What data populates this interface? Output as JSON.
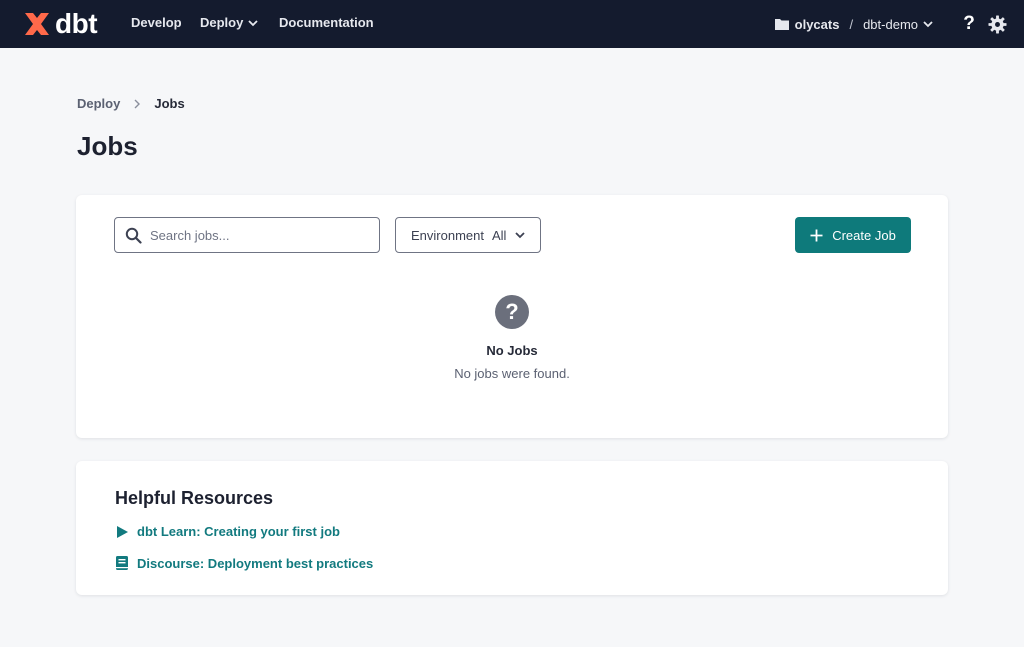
{
  "app": {
    "brand": "dbt",
    "brand_color": "#ff694a",
    "accent_color": "#0e7a7b"
  },
  "nav": {
    "items": [
      {
        "label": "Develop"
      },
      {
        "label": "Deploy",
        "has_dropdown": true
      },
      {
        "label": "Documentation"
      }
    ],
    "account": "olycats",
    "separator": "/",
    "project": "dbt-demo",
    "help_icon": "question-icon",
    "settings_icon": "gear-icon"
  },
  "breadcrumb": {
    "parent": "Deploy",
    "current": "Jobs"
  },
  "page": {
    "title": "Jobs"
  },
  "toolbar": {
    "search_placeholder": "Search jobs...",
    "environment_label": "Environment",
    "environment_value": "All",
    "create_label": "Create Job"
  },
  "empty_state": {
    "icon": "question-circle-icon",
    "title": "No Jobs",
    "subtitle": "No jobs were found."
  },
  "resources": {
    "title": "Helpful Resources",
    "links": [
      {
        "label": "dbt Learn: Creating your first job",
        "icon": "play-icon"
      },
      {
        "label": "Discourse: Deployment best practices",
        "icon": "book-icon"
      }
    ]
  }
}
